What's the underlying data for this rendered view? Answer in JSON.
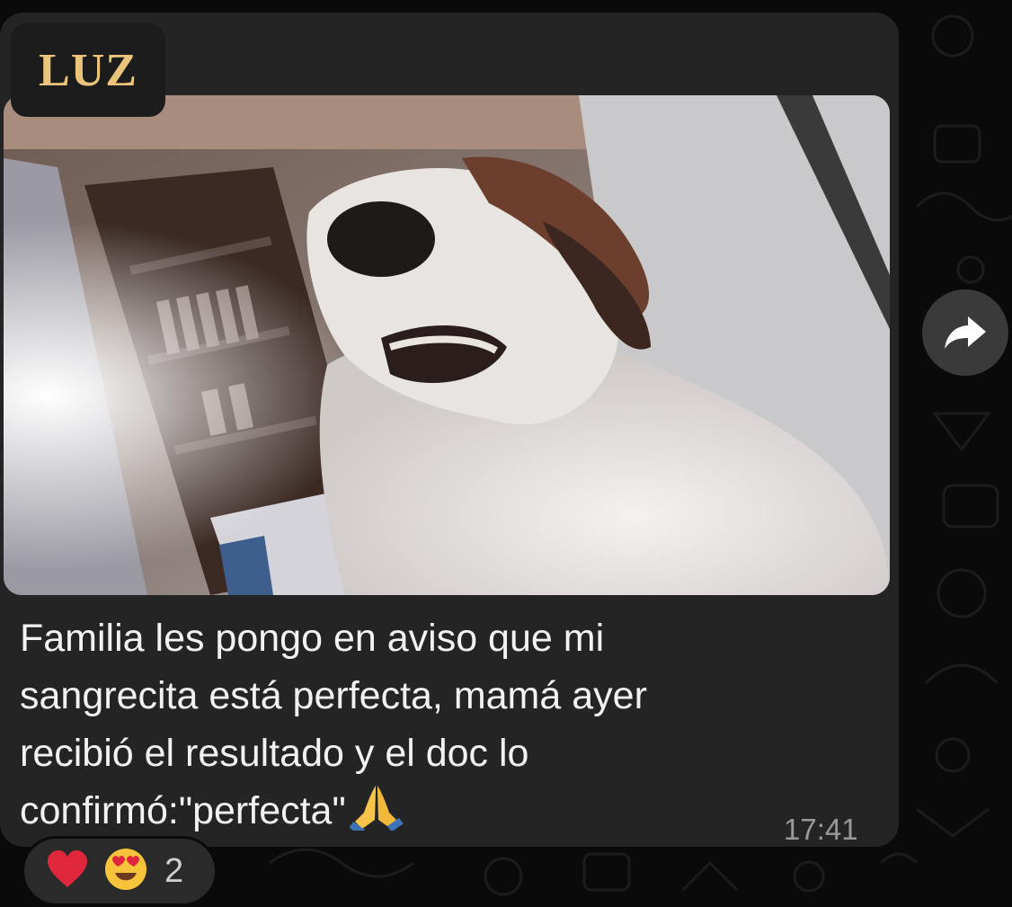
{
  "message": {
    "sender": "LUZ",
    "caption_lines": [
      "Familia les pongo en aviso que mi",
      "sangrecita está perfecta, mamá ayer",
      "recibió el resultado y el doc lo",
      "confirmó:\"perfecta\""
    ],
    "caption_emoji": "folded-hands-icon",
    "time": "17:41",
    "photo": "dog-photo"
  },
  "reactions": {
    "items": [
      "red-heart-icon",
      "heart-eyes-icon"
    ],
    "count": "2"
  },
  "actions": {
    "forward": "forward-icon"
  },
  "colors": {
    "bubble": "#242424",
    "sender_name": "#e9c47a",
    "caption_text": "#f2f2f2",
    "timestamp": "#9a9a9a"
  }
}
